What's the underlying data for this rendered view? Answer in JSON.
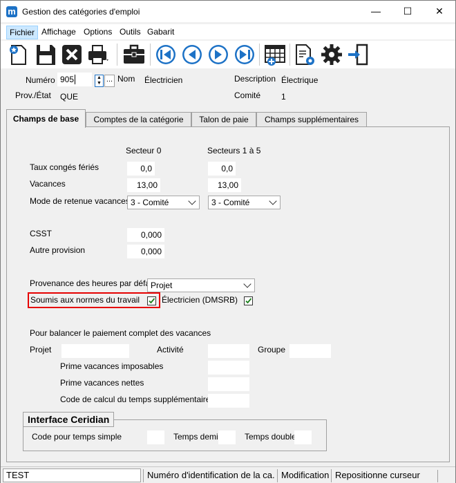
{
  "window": {
    "title": "Gestion des catégories d'emploi",
    "app_icon": "m"
  },
  "menu": [
    "Fichier",
    "Affichage",
    "Options",
    "Outils",
    "Gabarit"
  ],
  "toolbar": [
    "new-icon",
    "save-icon",
    "delete-icon",
    "print-icon",
    "briefcase-icon",
    "first-record-icon",
    "previous-record-icon",
    "next-record-icon",
    "last-record-icon",
    "grid-icon",
    "document-settings-icon",
    "gear-icon",
    "exit-icon"
  ],
  "header": {
    "numero_label": "Numéro",
    "numero_value": "905",
    "lookup_button": "...",
    "nom_label": "Nom",
    "nom_value": "Électricien",
    "description_label": "Description",
    "description_value": "Électrique",
    "prov_label": "Prov./État",
    "prov_value": "QUE",
    "comite_label": "Comité",
    "comite_value": "1"
  },
  "tabs": [
    "Champs de base",
    "Comptes de la catégorie",
    "Talon de paie",
    "Champs supplémentaires"
  ],
  "base": {
    "col_secteur0": "Secteur 0",
    "col_secteurs15": "Secteurs 1 à 5",
    "taux_label": "Taux congés fériés",
    "taux_s0": "0,0",
    "taux_s15": "0,0",
    "vacances_label": "Vacances",
    "vacances_s0": "13,00",
    "vacances_s15": "13,00",
    "mode_label": "Mode de retenue vacances",
    "mode_s0": "3 - Comité",
    "mode_s15": "3 - Comité",
    "csst_label": "CSST",
    "csst_value": "0,000",
    "autre_label": "Autre provision",
    "autre_value": "0,000",
    "provenance_label": "Provenance des heures par défaut",
    "provenance_value": "Projet",
    "soumis_label": "Soumis aux normes du travail",
    "soumis_checked": true,
    "electricien_label": "Électricien (DMSRB)",
    "electricien_checked": true,
    "balancer_label": "Pour balancer le paiement complet des vacances",
    "projet_label": "Projet",
    "activite_label": "Activité",
    "groupe_label": "Groupe",
    "prime_imposables_label": "Prime vacances imposables",
    "prime_nettes_label": "Prime vacances nettes",
    "code_calcul_label": "Code de calcul du temps supplémentaire"
  },
  "ceridian": {
    "title": "Interface Ceridian",
    "simple_label": "Code pour temps simple",
    "demi_label": "Temps demi",
    "double_label": "Temps double"
  },
  "status": {
    "input_value": "TEST",
    "field": "Numéro d'identification de la ca...",
    "mode": "Modification",
    "hint": "Repositionne curseur"
  }
}
